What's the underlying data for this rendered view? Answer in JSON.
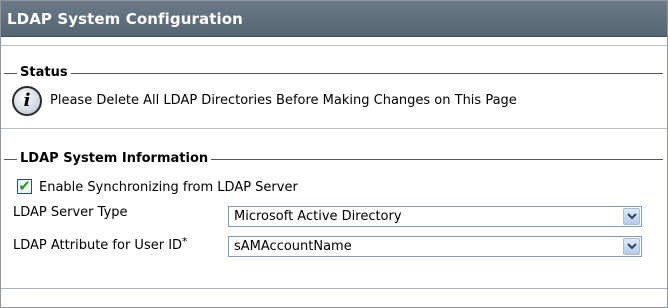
{
  "window": {
    "title": "LDAP System Configuration"
  },
  "status": {
    "legend": "Status",
    "icon": "info-icon",
    "message": "Please Delete All LDAP Directories Before Making Changes on This Page"
  },
  "system_info": {
    "legend": "LDAP System Information",
    "sync_checkbox": {
      "label": "Enable Synchronizing from LDAP Server",
      "checked": true
    },
    "server_type": {
      "label": "LDAP Server Type",
      "value": "Microsoft Active Directory"
    },
    "user_id_attr": {
      "label": "LDAP Attribute for User ID",
      "required_mark": "*",
      "value": "sAMAccountName"
    }
  },
  "colors": {
    "title_bar": "#5f6e7c",
    "check": "#21a121",
    "select_border": "#7f9db9"
  }
}
